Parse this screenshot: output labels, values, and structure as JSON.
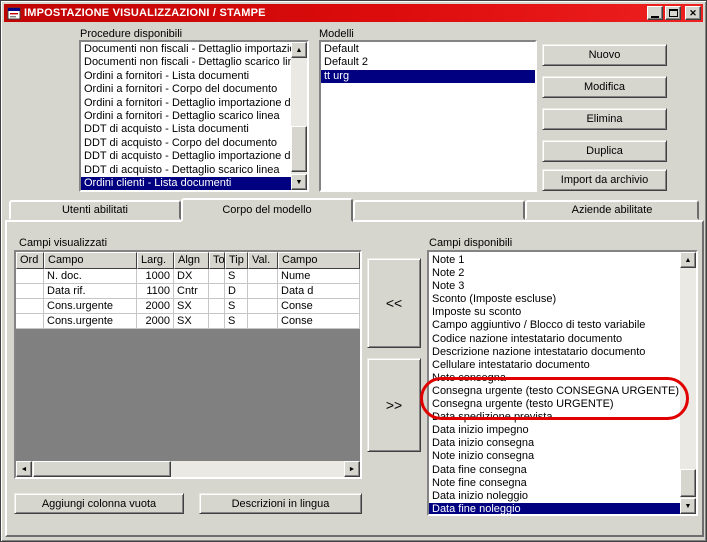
{
  "window": {
    "title": "IMPOSTAZIONE VISUALIZZAZIONI / STAMPE",
    "controls": {
      "minimize_icon": "minimize-icon",
      "maximize_icon": "maximize-icon",
      "close_icon": "close-icon"
    }
  },
  "colors": {
    "titlebar_red": "#dd0c0c",
    "selection_blue": "#000080",
    "dialog_gray": "#d6d6ce",
    "annotation_red": "#e00000",
    "grid_empty_gray": "#808080"
  },
  "procedures": {
    "label": "Procedure disponibili",
    "selected_index": 10,
    "items": [
      "Documenti non fiscali - Dettaglio importazione",
      "Documenti non fiscali - Dettaglio scarico linea",
      "Ordini a fornitori - Lista documenti",
      "Ordini a fornitori - Corpo del documento",
      "Ordini a fornitori - Dettaglio importazione da al",
      "Ordini a fornitori - Dettaglio scarico linea",
      "DDT di acquisto - Lista documenti",
      "DDT di acquisto - Corpo del documento",
      "DDT di acquisto - Dettaglio importazione da a",
      "DDT di acquisto - Dettaglio scarico linea",
      "Ordini clienti - Lista documenti"
    ]
  },
  "models": {
    "label": "Modelli",
    "selected_index": 2,
    "items": [
      "Default",
      "Default 2",
      "tt urg"
    ]
  },
  "actions": {
    "nuovo": "Nuovo",
    "modifica": "Modifica",
    "elimina": "Elimina",
    "duplica": "Duplica",
    "import_da_archivio": "Import da archivio"
  },
  "tabs": {
    "active_index": 1,
    "labels": [
      "Utenti abilitati",
      "Corpo del modello",
      "",
      "Aziende abilitate"
    ]
  },
  "fields_grid": {
    "label": "Campi visualizzati",
    "columns": [
      "Ord",
      "Campo",
      "Larg.",
      "Algn",
      "To",
      "Tip",
      "Val.",
      "Campo"
    ],
    "rows": [
      [
        "",
        "N. doc.",
        "1000",
        "DX",
        "",
        "S",
        "",
        "Nume"
      ],
      [
        "",
        "Data rif.",
        "1100",
        "Cntr",
        "",
        "D",
        "",
        "Data d"
      ],
      [
        "",
        "Cons.urgente",
        "2000",
        "SX",
        "",
        "S",
        "",
        "Conse"
      ],
      [
        "",
        "Cons.urgente",
        "2000",
        "SX",
        "",
        "S",
        "",
        "Conse"
      ]
    ]
  },
  "transfer": {
    "left_label": "<<",
    "right_label": ">>"
  },
  "available_fields": {
    "label": "Campi disponibili",
    "selected_index": 19,
    "circled_items": [
      "Consegna urgente (testo CONSEGNA URGENTE)",
      "Consegna urgente (testo URGENTE)"
    ],
    "items": [
      "Note 1",
      "Note 2",
      "Note 3",
      "Sconto (Imposte escluse)",
      "Imposte su sconto",
      "Campo aggiuntivo / Blocco di testo variabile",
      "Codice nazione intestatario documento",
      "Descrizione nazione intestatario documento",
      "Cellulare intestatario documento",
      "Note consegna",
      "Consegna urgente (testo CONSEGNA URGENTE)",
      "Consegna urgente (testo URGENTE)",
      "Data spedizione prevista",
      "Data inizio impegno",
      "Data inizio consegna",
      "Note inizio consegna",
      "Data fine consegna",
      "Note fine consegna",
      "Data inizio noleggio",
      "Data fine noleggio"
    ]
  },
  "footer": {
    "add_empty_column": "Aggiungi colonna vuota",
    "descriptions_in_language": "Descrizioni in lingua"
  }
}
